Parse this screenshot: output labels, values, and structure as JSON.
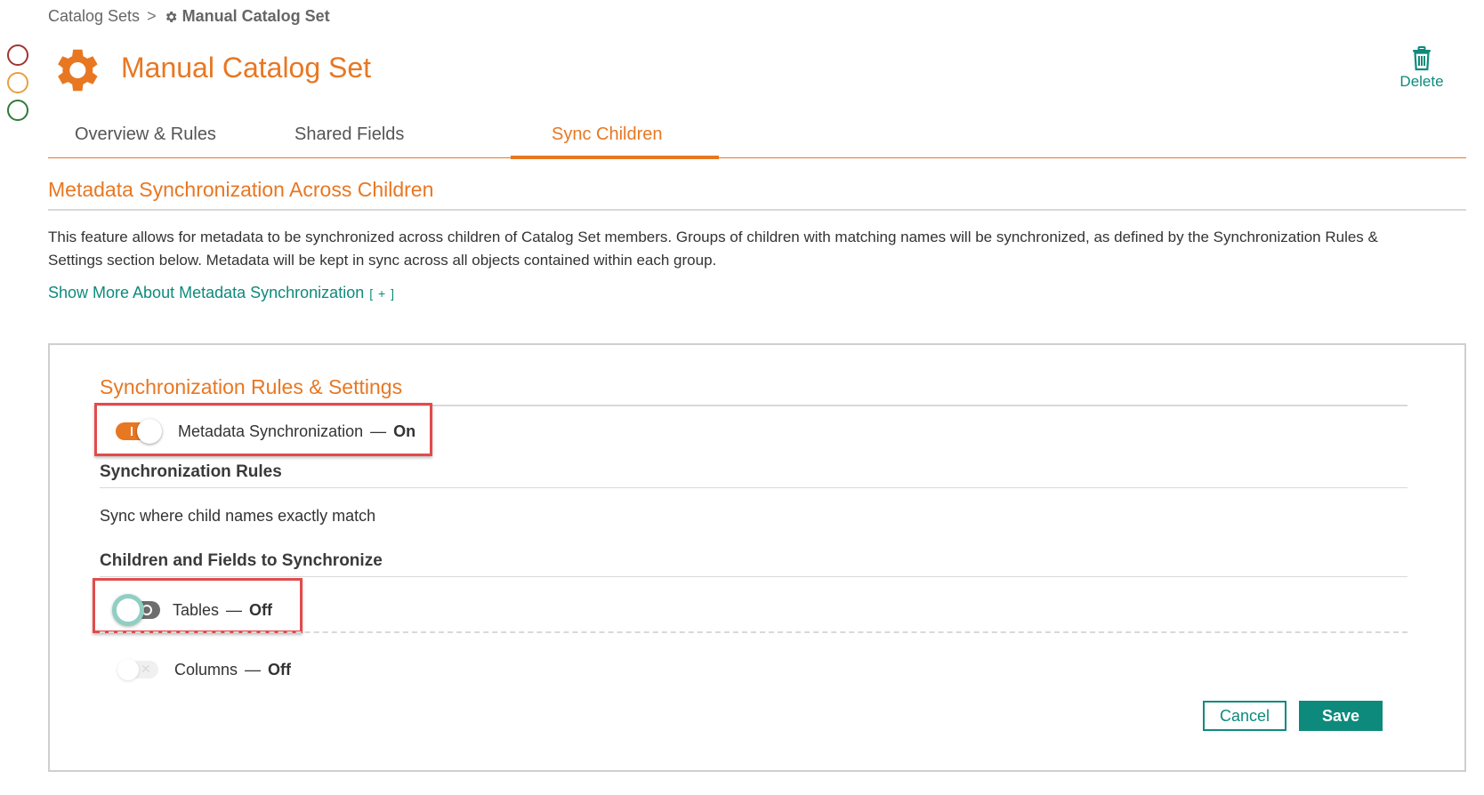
{
  "breadcrumb": {
    "parent": "Catalog Sets",
    "separator": ">",
    "current": "Manual Catalog Set"
  },
  "header": {
    "title": "Manual Catalog Set",
    "icon": "gear-icon",
    "delete_label": "Delete"
  },
  "tabs": [
    {
      "label": "Overview & Rules",
      "active": false
    },
    {
      "label": "Shared Fields",
      "active": false
    },
    {
      "label": "Sync Children",
      "active": true
    }
  ],
  "section": {
    "title": "Metadata Synchronization Across Children",
    "description": "This feature allows for metadata to be synchronized across children of Catalog Set members. Groups of children with matching names will be synchronized, as defined by the Synchronization Rules & Settings section below. Metadata will be kept in sync across all objects contained within each group.",
    "show_more": "Show More About Metadata Synchronization",
    "show_more_toggle": "[ + ]"
  },
  "panel": {
    "title": "Synchronization Rules & Settings",
    "metadata_sync": {
      "label": "Metadata Synchronization",
      "dash": "—",
      "state": "On"
    },
    "rules_heading": "Synchronization Rules",
    "rules_text": "Sync where child names exactly match",
    "children_heading": "Children and Fields to Synchronize",
    "tables": {
      "label": "Tables",
      "dash": "—",
      "state": "Off"
    },
    "columns": {
      "label": "Columns",
      "dash": "—",
      "state": "Off"
    },
    "cancel_label": "Cancel",
    "save_label": "Save"
  },
  "colors": {
    "accent": "#e87722",
    "teal": "#0e8a7d",
    "highlight": "#e24b4b"
  }
}
